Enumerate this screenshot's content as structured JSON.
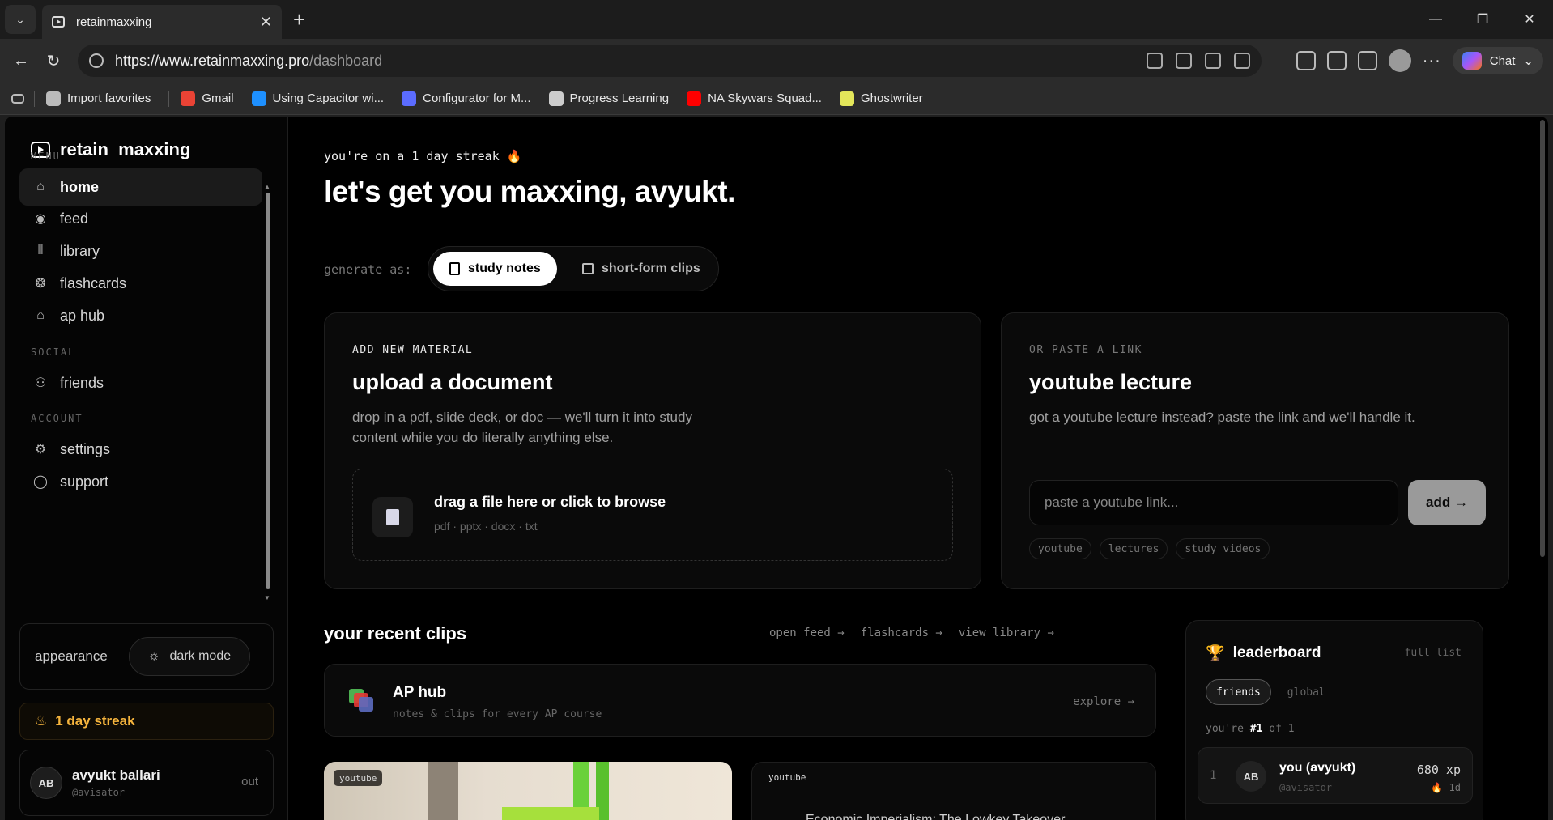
{
  "browser": {
    "tab_title": "retainmaxxing",
    "url_host": "https://www.retainmaxxing.pro",
    "url_path": "/dashboard",
    "chat_label": "Chat",
    "bookmarks": [
      {
        "label": "Import favorites",
        "color": "#bbbbbb"
      },
      {
        "label": "Gmail",
        "color": "#ea4335"
      },
      {
        "label": "Using Capacitor wi...",
        "color": "#1e90ff"
      },
      {
        "label": "Configurator for M...",
        "color": "#5b6cff"
      },
      {
        "label": "Progress Learning",
        "color": "#cccccc"
      },
      {
        "label": "NA Skywars Squad...",
        "color": "#ff0000"
      },
      {
        "label": "Ghostwriter",
        "color": "#e3e65a"
      }
    ]
  },
  "sidebar": {
    "brand": "retain  maxxing",
    "menu_label": "MENU",
    "social_label": "SOCIAL",
    "account_label": "ACCOUNT",
    "items": {
      "home": "home",
      "feed": "feed",
      "library": "library",
      "flashcards": "flashcards",
      "ap_hub": "ap hub",
      "friends": "friends",
      "settings": "settings",
      "support": "support"
    },
    "appearance_label": "appearance",
    "dark_mode_label": "dark mode",
    "streak_label": "1 day streak",
    "user": {
      "initials": "AB",
      "name": "avyukt ballari",
      "handle": "@avisator",
      "out": "out"
    }
  },
  "main": {
    "streak_line": "you're on a 1 day streak 🔥",
    "hero": "let's get you maxxing, avyukt.",
    "generate_label": "generate as:",
    "gen_options": {
      "notes": "study notes",
      "clips": "short-form clips"
    },
    "upload": {
      "kicker": "ADD NEW MATERIAL",
      "title": "upload a document",
      "desc": "drop in a pdf, slide deck, or doc — we'll turn it into study content while you do literally anything else.",
      "drop_title": "drag a file here or click to browse",
      "drop_sub": "pdf · pptx · docx · txt"
    },
    "youtube": {
      "kicker": "OR PASTE A LINK",
      "title": "youtube lecture",
      "desc": "got a youtube lecture instead? paste the link and we'll handle it.",
      "placeholder": "paste a youtube link...",
      "add": "add →",
      "chips": [
        "youtube",
        "lectures",
        "study videos"
      ]
    },
    "recent": {
      "title": "your recent clips",
      "links": [
        "open feed →",
        "flashcards →",
        "view library →"
      ]
    },
    "aphub": {
      "title": "AP hub",
      "sub": "notes & clips for every AP course",
      "explore": "explore →"
    },
    "clips": [
      {
        "tag": "youtube"
      },
      {
        "tag": "youtube",
        "title": "Economic Imperialism: The Lowkey Takeover"
      }
    ],
    "leaderboard": {
      "title": "leaderboard",
      "full": "full list",
      "tab_friends": "friends",
      "tab_global": "global",
      "rank_prefix": "you're ",
      "rank": "#1",
      "rank_suffix": " of 1",
      "row": {
        "num": "1",
        "initials": "AB",
        "name": "you (avyukt)",
        "handle": "@avisator",
        "xp": "680 xp",
        "days": "🔥 1d"
      }
    }
  }
}
